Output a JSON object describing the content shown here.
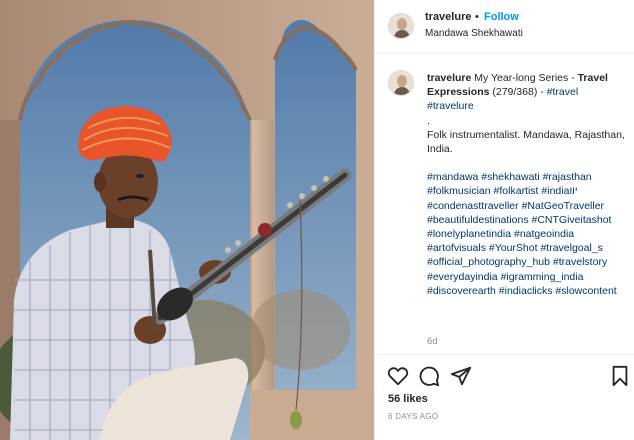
{
  "post": {
    "username": "travelure",
    "follow_label": "Follow",
    "separator": "•",
    "location": "Mandawa Shekhawati",
    "caption": {
      "lead": "My Year-long Series -",
      "series_title": "Travel Expressions",
      "series_count": "(279/368) -",
      "tags_line_1": "#travel #travelure",
      "dot": ".",
      "body": "Folk instrumentalist. Mandawa, Rajasthan, India.",
      "hashtags": [
        "#mandawa",
        "#shekhawati",
        "#rajasthan",
        "#folkmusician",
        "#folkartist",
        "#indiaיוו",
        "#condenasttraveller",
        "#NatGeoTraveller",
        "#beautifuldestinations",
        "#CNTGiveitashot",
        "#lonelyplanetindia",
        "#natgeoindia",
        "#artofvisuals",
        "#YourShot",
        "#travelgoal_s",
        "#official_photography_hub",
        "#travelstory",
        "#everydayindia",
        "#igramming_india",
        "#discoverearth",
        "#indiaclicks",
        "#slowcontent"
      ],
      "age": "6d"
    },
    "likes": "56 likes",
    "timestamp": "6 DAYS AGO"
  },
  "icons": {
    "like": "heart-icon",
    "comment": "comment-icon",
    "share": "paper-plane-icon",
    "save": "bookmark-icon"
  },
  "colors": {
    "link": "#0095f6",
    "hashtag": "#00376b",
    "muted": "#8e8e8e",
    "border": "#efefef",
    "turban": "#e8552b",
    "sky": "#6f8fb0"
  }
}
